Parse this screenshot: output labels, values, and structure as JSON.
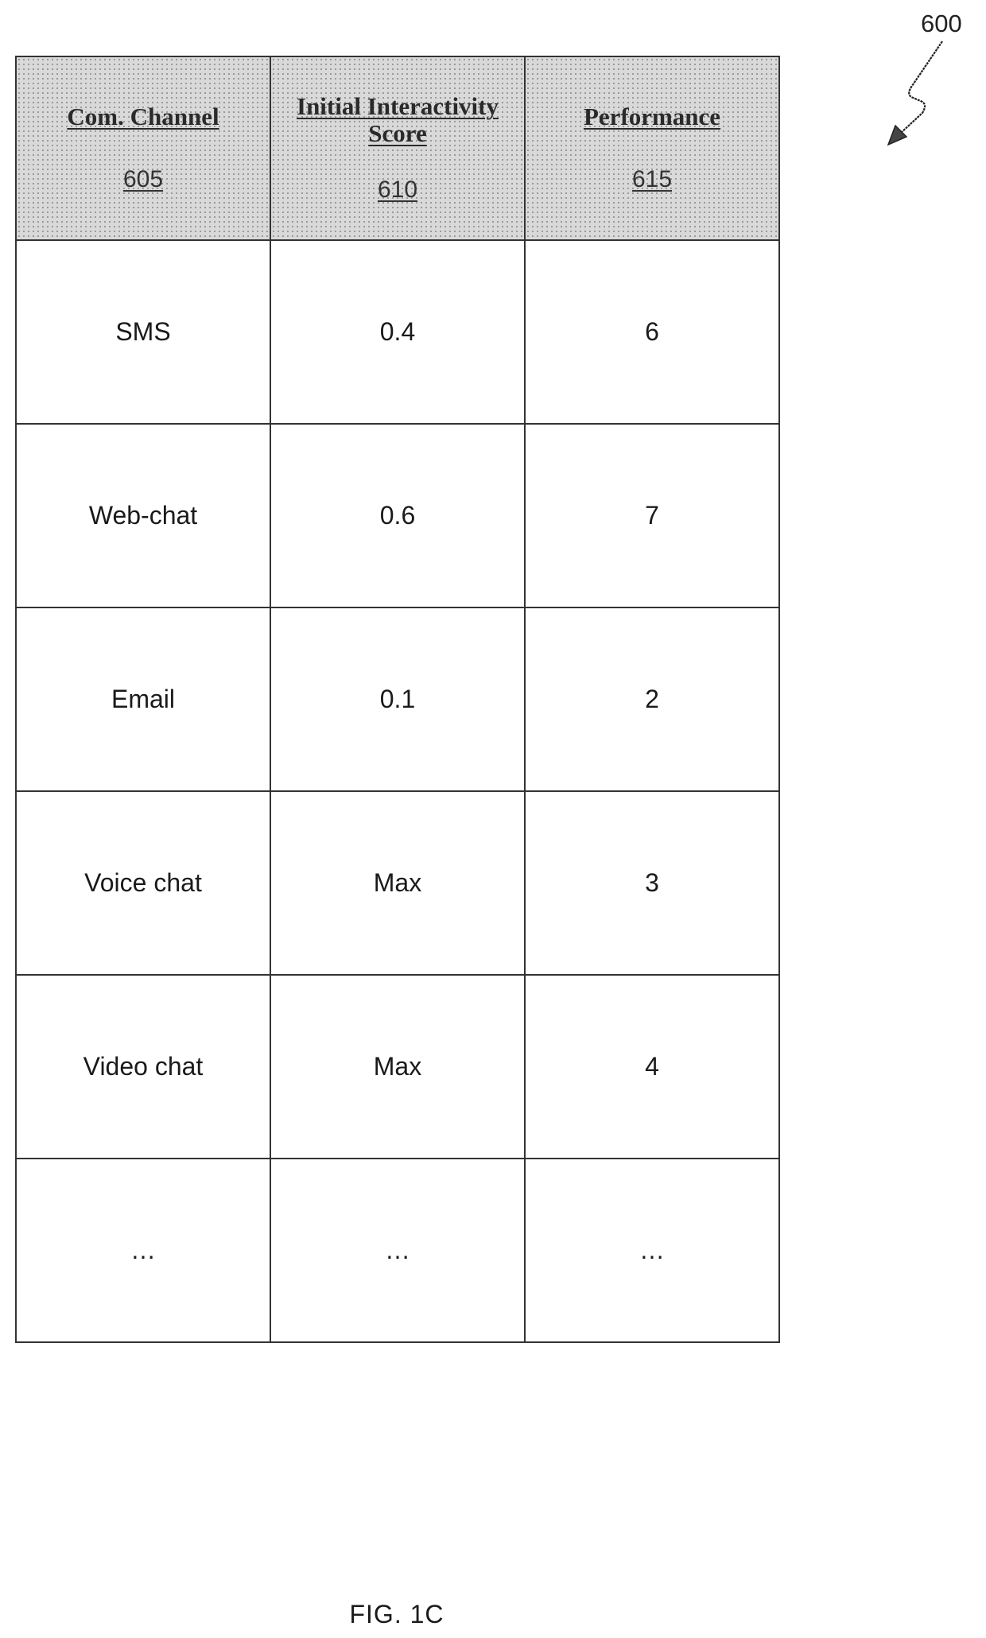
{
  "figure": {
    "reference_number": "600",
    "caption": "FIG. 1C"
  },
  "table": {
    "columns": [
      {
        "title": "Com. Channel",
        "ref": "605"
      },
      {
        "title": "Initial Interactivity Score",
        "ref": "610"
      },
      {
        "title": "Performance",
        "ref": "615"
      }
    ],
    "rows": [
      {
        "channel": "SMS",
        "score": "0.4",
        "performance": "6"
      },
      {
        "channel": "Web-chat",
        "score": "0.6",
        "performance": "7"
      },
      {
        "channel": "Email",
        "score": "0.1",
        "performance": "2"
      },
      {
        "channel": "Voice chat",
        "score": "Max",
        "performance": "3"
      },
      {
        "channel": "Video chat",
        "score": "Max",
        "performance": "4"
      },
      {
        "channel": "…",
        "score": "…",
        "performance": "…"
      }
    ]
  },
  "icons": {
    "reference_arrow": "zigzag-leader-arrow-icon"
  }
}
